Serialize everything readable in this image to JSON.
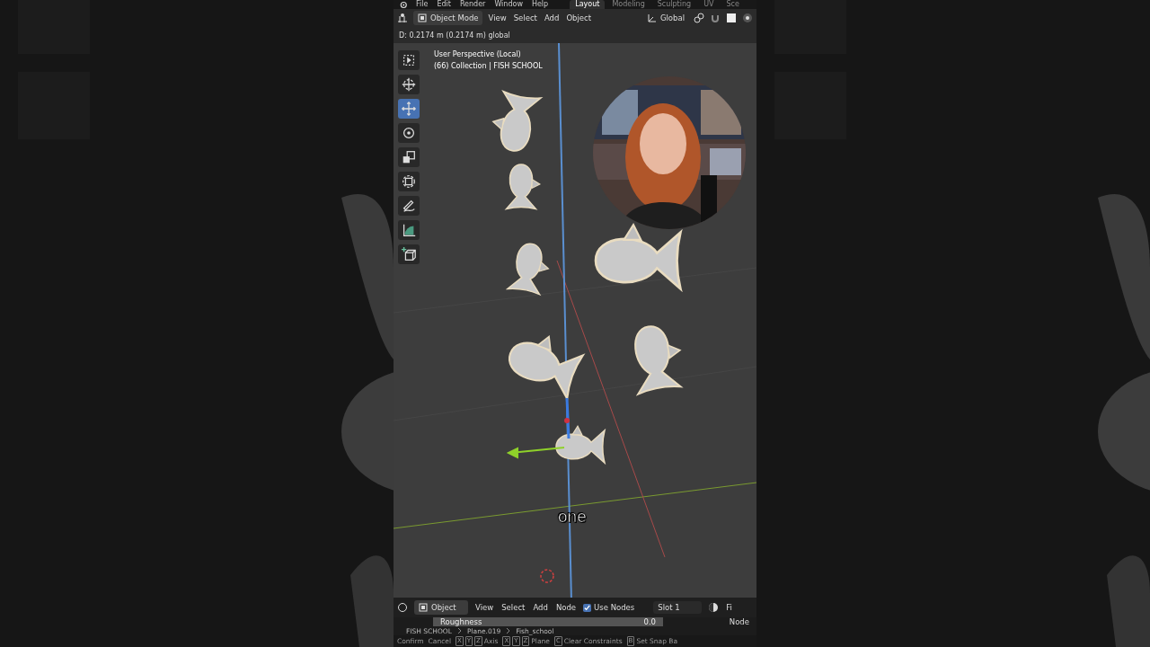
{
  "top_menu": [
    "File",
    "Edit",
    "Render",
    "Window",
    "Help"
  ],
  "workspace_tabs": [
    {
      "label": "Layout",
      "selected": true
    },
    {
      "label": "Modeling",
      "selected": false
    },
    {
      "label": "Sculpting",
      "selected": false
    },
    {
      "label": "UV",
      "selected": false
    },
    {
      "label": "Sce",
      "selected": false
    }
  ],
  "viewport_header": {
    "mode": "Object Mode",
    "menus": [
      "View",
      "Select",
      "Add",
      "Object"
    ],
    "orientation": "Global"
  },
  "operator_status": "D: 0.2174 m (0.2174 m) global",
  "viewport": {
    "overlay_lines": [
      "User Perspective (Local)",
      "(66) Collection | FISH SCHOOL"
    ],
    "tools": [
      {
        "kind": "select",
        "selected": false
      },
      {
        "kind": "cursor",
        "selected": false
      },
      {
        "kind": "move",
        "selected": true
      },
      {
        "kind": "rotate",
        "selected": false
      },
      {
        "kind": "scale",
        "selected": false
      },
      {
        "kind": "transform",
        "selected": false
      },
      {
        "kind": "annotate",
        "selected": false
      },
      {
        "kind": "measure",
        "selected": false
      },
      {
        "kind": "add_cube",
        "selected": false
      }
    ],
    "subtitle": "one"
  },
  "node_header": {
    "mode": "Object",
    "menus": [
      "View",
      "Select",
      "Add",
      "Node"
    ],
    "use_nodes": {
      "label": "Use Nodes",
      "checked": true
    },
    "slot": "Slot 1",
    "tail": "Fi"
  },
  "properties": {
    "field": "Roughness",
    "value": "0.0",
    "panel": "Node"
  },
  "breadcrumbs": [
    "FISH SCHOOL",
    "Plane.019",
    "Fish_school"
  ],
  "status_bar": [
    {
      "label": "Confirm"
    },
    {
      "label": "Cancel"
    },
    {
      "keys": [
        "X",
        "Y",
        "Z"
      ],
      "label": "Axis"
    },
    {
      "keys": [
        "X",
        "Y",
        "Z"
      ],
      "label": "Plane"
    },
    {
      "keys": [
        "C"
      ],
      "label": "Clear Constraints"
    },
    {
      "keys": [
        "B"
      ],
      "label": "Set Snap Ba"
    }
  ]
}
